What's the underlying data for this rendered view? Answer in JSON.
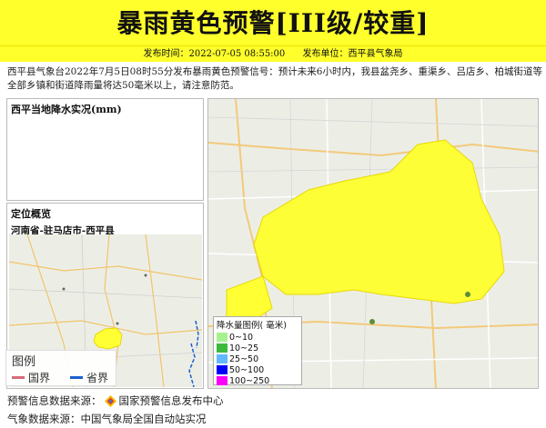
{
  "header": {
    "title": "暴雨黄色预警[III级/较重]",
    "publish_time_label": "发布时间：2022-07-05 08:55:00",
    "publisher_label": "发布单位：西平县气象局"
  },
  "description": "西平县气象台2022年7月5日08时55分发布暴雨黄色预警信号：预计未来6小时内，我县盆尧乡、重渠乡、吕店乡、柏城街道等全部乡镇和街道降雨量将达50毫米以上，请注意防范。",
  "rain_panel": {
    "title": "西平当地降水实况(mm)"
  },
  "location_panel": {
    "title": "定位概览",
    "region": "河南省-驻马店市-西平县",
    "legend": {
      "title": "图例",
      "national_border": "国界",
      "provincial_border": "省界",
      "national_color": "#d86a7a",
      "provincial_color": "#1a5fd0"
    }
  },
  "main_map": {
    "warning_color": "#ffff33",
    "rain_legend": {
      "title": "降水量图例( 毫米)",
      "items": [
        {
          "label": "0~10",
          "color": "#a6f28f"
        },
        {
          "label": "10~25",
          "color": "#3dba3d"
        },
        {
          "label": "25~50",
          "color": "#61b8ff"
        },
        {
          "label": "50~100",
          "color": "#0000ff"
        },
        {
          "label": "100~250",
          "color": "#fa00fa"
        }
      ]
    }
  },
  "footer": {
    "source_label": "预警信息数据来源：",
    "source_name": "国家预警信息发布中心",
    "weather_label": "气象数据来源：中国气象局全国自动站实况"
  }
}
